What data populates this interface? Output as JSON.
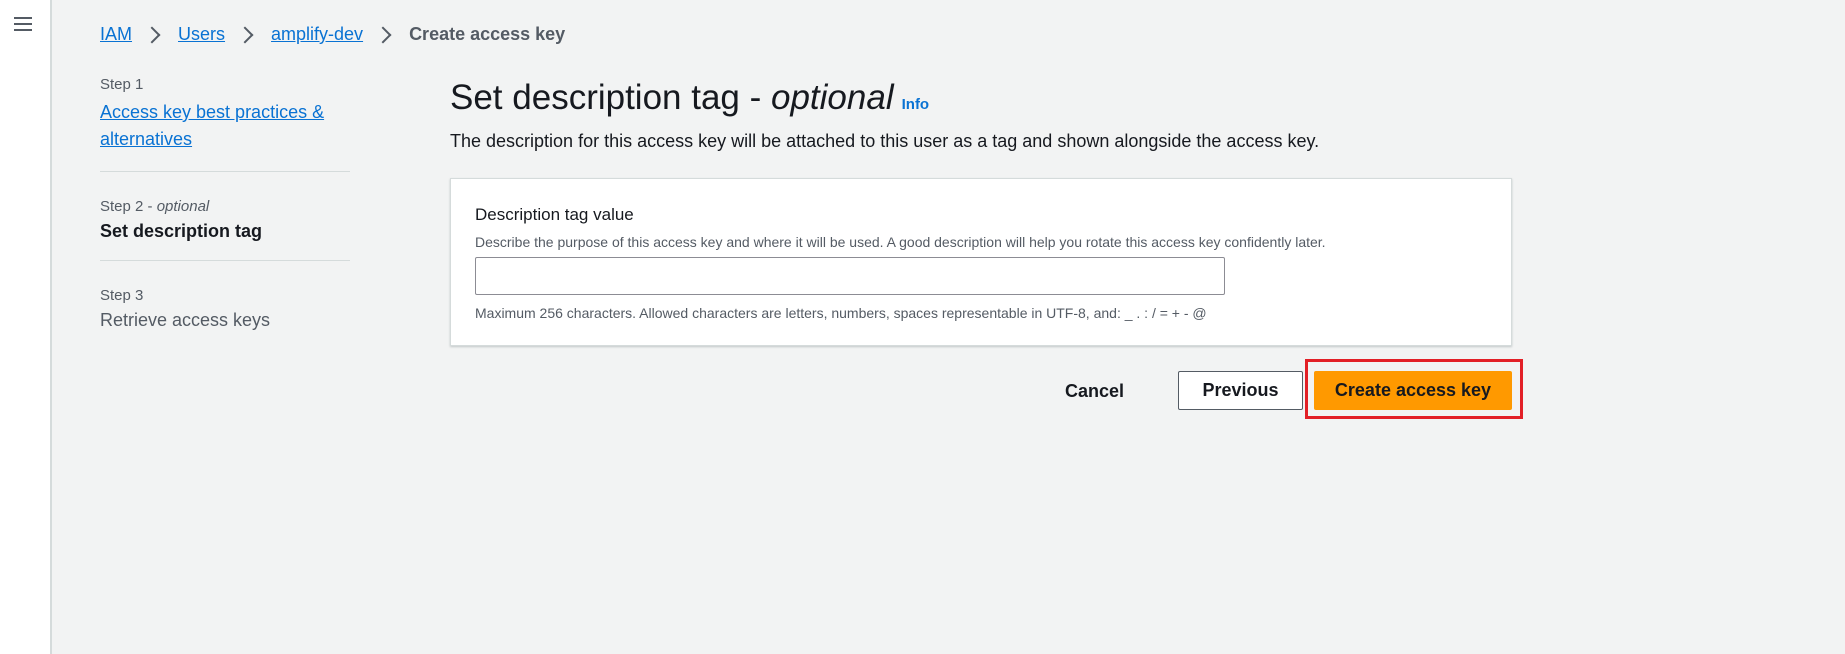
{
  "nav": {
    "menu_icon": "hamburger-menu-icon"
  },
  "breadcrumb": {
    "items": [
      "IAM",
      "Users",
      "amplify-dev"
    ],
    "current": "Create access key"
  },
  "steps": [
    {
      "number": "Step 1",
      "title": "Access key best practices & alternatives"
    },
    {
      "number": "Step 2 - ",
      "optional": "optional",
      "title": "Set description tag"
    },
    {
      "number": "Step 3",
      "title": "Retrieve access keys"
    }
  ],
  "main": {
    "title": "Set description tag - ",
    "title_optional": "optional",
    "info_label": "Info",
    "description": "The description for this access key will be attached to this user as a tag and shown alongside the access key."
  },
  "form": {
    "label": "Description tag value",
    "help": "Describe the purpose of this access key and where it will be used. A good description will help you rotate this access key confidently later.",
    "value": "",
    "placeholder": "",
    "constraint": "Maximum 256 characters. Allowed characters are letters, numbers, spaces representable in UTF-8, and: _ . : / = + - @"
  },
  "actions": {
    "cancel_label": "Cancel",
    "previous_label": "Previous",
    "create_label": "Create access key"
  },
  "colors": {
    "primary_button": "#ff9900",
    "link": "#0972d3",
    "highlight": "#e21f26"
  }
}
